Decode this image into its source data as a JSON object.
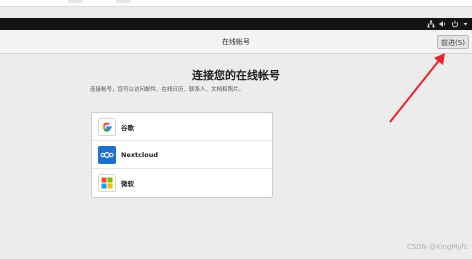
{
  "window": {
    "title": "在线帐号",
    "previous_button_label": "前进(S)"
  },
  "system_tray": {
    "icons": [
      "network-icon",
      "volume-icon",
      "power-icon",
      "chevron-down-icon"
    ]
  },
  "main": {
    "heading": "连接您的在线帐号",
    "description": "连接帐号，您可以访问邮件、在线日历、联系人、文档和照片。"
  },
  "providers": [
    {
      "name": "谷歌",
      "icon": "google-icon"
    },
    {
      "name": "Nextcloud",
      "icon": "nextcloud-icon"
    },
    {
      "name": "微软",
      "icon": "microsoft-icon"
    }
  ],
  "colors": {
    "annotation_arrow": "#e8252e",
    "top_bar": "#141414"
  },
  "watermark": "CSDN @KingMyfc"
}
